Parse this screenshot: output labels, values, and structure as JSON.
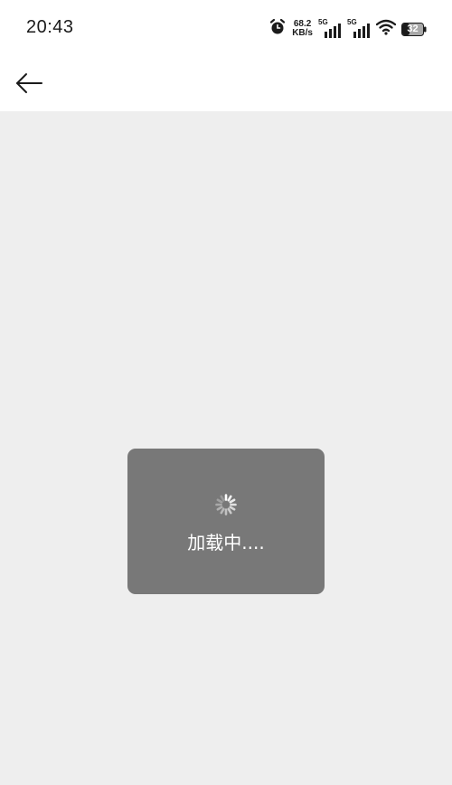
{
  "status_bar": {
    "time": "20:43",
    "net_speed_value": "68.2",
    "net_speed_unit": "KB/s",
    "sim1_label": "5G",
    "sim2_label": "5G",
    "battery_level": "32",
    "icons": [
      "alarm-icon",
      "signal-icon",
      "signal-icon",
      "wifi-icon",
      "battery-icon"
    ]
  },
  "app_bar": {
    "back_icon": "arrow-left-icon"
  },
  "loading": {
    "text": "加载中....",
    "icon": "spinner-icon",
    "background": "#787878"
  },
  "colors": {
    "page_background": "#eeeeee",
    "bar_background": "#ffffff"
  }
}
